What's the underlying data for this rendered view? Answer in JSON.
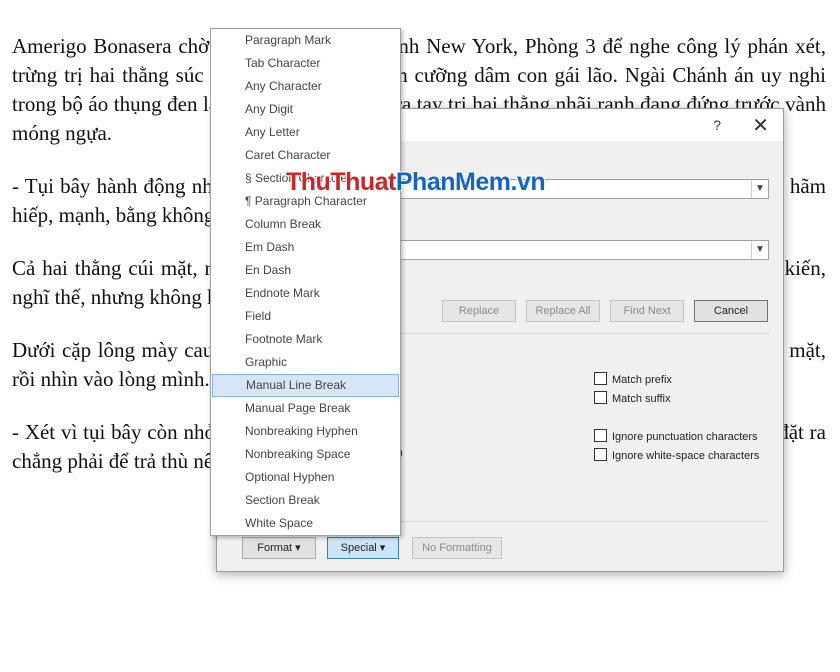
{
  "document": {
    "paragraphs": [
      "Amerigo Bonasera chờ đợi ngồi ở tòa Đại-hình New York, Phòng 3 để nghe công lý phán xét, trừng trị hai thằng súc sinh tội bạo hành, toan cưỡng dâm con gái lão. Ngài Chánh án uy nghi trong bộ áo thụng đen làm như sắp đích thân ra tay trị hai thằng nhãi ranh đang đứng trước vành móng ngựa.",
      "- Tụi bây hành động như thú vật, cứ như dã thú ở rừng vậy! Cũng may là con bé không bị hãm hiếp, mạnh, bằng không thì mỗi đứa phải 20 năm tù!",
      "Cả hai thằng cúi mặt, ra điều hối hận lắm, nhưng chó sủa quá. Nhưng chúng cũng đã có kiến, nghĩ thế, nhưng không hiểu cái lão già nhà tôi ở bên trong vụ xử này.",
      "Dưới cặp lông mày cau, nhìn khuôn mặt bí xị của hai đứa, trừng trừng vào mặt. Ngài cau mặt, rồi nhìn vào lòng mình.",
      "- Xét vì tụi bây còn nhỏ, chưa có tiền án và con nhà đàng hoàng… Và lại xét vì luật pháp đặt ra chẳng phải để trả thù nên toà tuyên phạt mỗi đứa 3 năm tù, cho hưởng án treo!"
    ]
  },
  "dialog": {
    "help_glyph": "?",
    "close_glyph": "✕",
    "buttons": {
      "replace": "Replace",
      "replace_all": "Replace All",
      "find_next": "Find Next",
      "cancel": "Cancel",
      "format": "Format ▾",
      "special": "Special ▾",
      "no_formatting": "No Formatting"
    },
    "checkboxes": {
      "match_prefix": "Match prefix",
      "match_suffix": "Match suffix",
      "ignore_punct": "Ignore punctuation characters",
      "ignore_space": "Ignore white-space characters"
    },
    "partial_text": ")"
  },
  "menu": {
    "items": [
      "Paragraph Mark",
      "Tab Character",
      "Any Character",
      "Any Digit",
      "Any Letter",
      "Caret Character",
      "§ Section Character",
      "¶ Paragraph Character",
      "Column Break",
      "Em Dash",
      "En Dash",
      "Endnote Mark",
      "Field",
      "Footnote Mark",
      "Graphic",
      "Manual Line Break",
      "Manual Page Break",
      "Nonbreaking Hyphen",
      "Nonbreaking Space",
      "Optional Hyphen",
      "Section Break",
      "White Space"
    ],
    "highlighted": "Manual Line Break"
  },
  "watermark": {
    "part1": "Thu",
    "part2": "Thuat",
    "part3": "PhanMem",
    "part4": ".vn",
    "color1": "#c62828",
    "color2": "#1565c0"
  }
}
